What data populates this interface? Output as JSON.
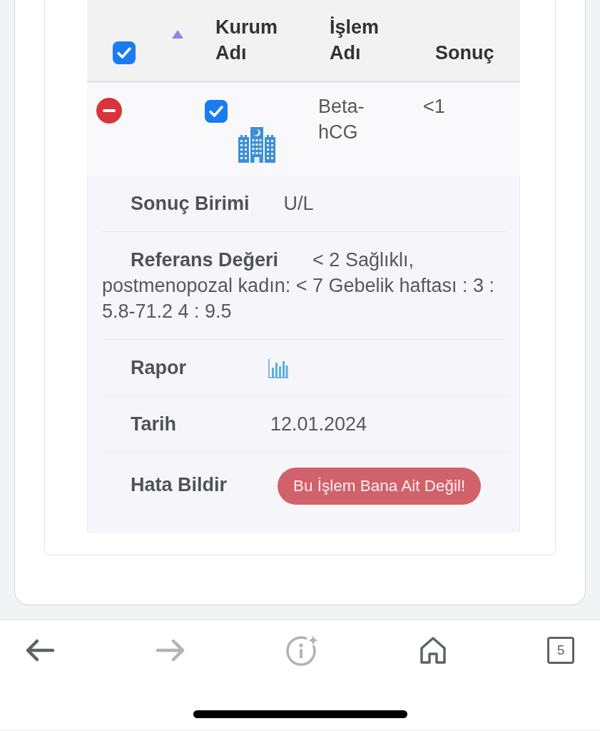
{
  "table": {
    "columns": [
      {
        "kind": "select",
        "checked": true
      },
      {
        "kind": "sort",
        "ascending": true
      },
      {
        "kind": "label",
        "label": "Kurum Adı"
      },
      {
        "kind": "label",
        "label": "İşlem Adı"
      },
      {
        "kind": "label",
        "label": "Sonuç"
      }
    ],
    "rows": [
      {
        "expanded": true,
        "checked": true,
        "operation": "Beta-hCG",
        "result": "<1",
        "details": [
          {
            "kind": "text",
            "label": "Sonuç Birimi",
            "value": "U/L"
          },
          {
            "kind": "text",
            "label": "Referans Değeri",
            "value": "< 2 Sağlıklı, postmenopozal kadın: < 7 Gebelik haftası : 3 : 5.8-71.2 4 : 9.5"
          },
          {
            "kind": "report",
            "label": "Rapor"
          },
          {
            "kind": "text",
            "label": "Tarih",
            "value": "12.01.2024"
          },
          {
            "kind": "button",
            "label": "Hata Bildir",
            "button": "Bu İşlem Bana Ait Değil!"
          }
        ]
      }
    ]
  },
  "toolbar": [
    {
      "kind": "back",
      "disabled": false
    },
    {
      "kind": "forward",
      "disabled": true
    },
    {
      "kind": "info",
      "disabled": true
    },
    {
      "kind": "home",
      "disabled": false
    },
    {
      "kind": "tabs",
      "count": "5",
      "disabled": false
    }
  ]
}
